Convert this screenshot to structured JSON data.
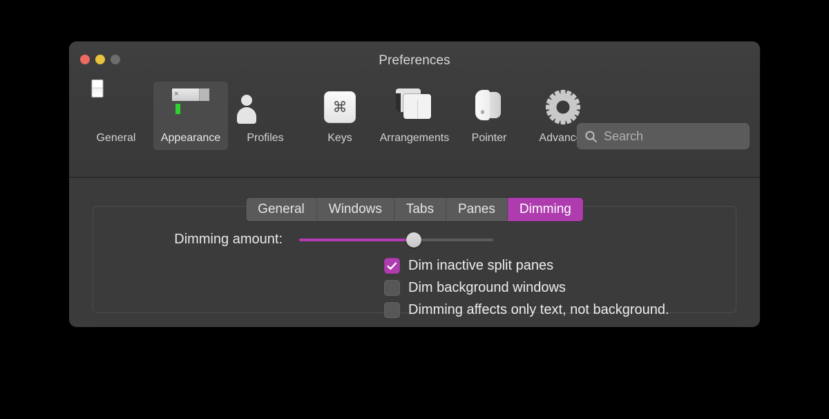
{
  "window": {
    "title": "Preferences",
    "traffic_lights": [
      {
        "name": "close",
        "color": "#ec6a5f"
      },
      {
        "name": "minimize",
        "color": "#e8c33c"
      },
      {
        "name": "zoom",
        "color": "#6d6d6d"
      }
    ]
  },
  "toolbar": {
    "items": [
      {
        "label": "General",
        "icon": "toggle-switch-icon",
        "selected": false
      },
      {
        "label": "Appearance",
        "icon": "terminal-window-icon",
        "selected": true
      },
      {
        "label": "Profiles",
        "icon": "person-circle-icon",
        "selected": false
      },
      {
        "label": "Keys",
        "icon": "command-key-icon",
        "selected": false
      },
      {
        "label": "Arrangements",
        "icon": "stacked-windows-icon",
        "selected": false
      },
      {
        "label": "Pointer",
        "icon": "mouse-icon",
        "selected": false
      },
      {
        "label": "Advanced",
        "icon": "gear-icon",
        "selected": false
      }
    ],
    "search": {
      "icon": "search-icon",
      "placeholder": "Search",
      "value": ""
    }
  },
  "content": {
    "tabs": [
      {
        "label": "General",
        "active": false
      },
      {
        "label": "Windows",
        "active": false
      },
      {
        "label": "Tabs",
        "active": false
      },
      {
        "label": "Panes",
        "active": false
      },
      {
        "label": "Dimming",
        "active": true
      }
    ],
    "slider": {
      "label": "Dimming amount:",
      "value_percent": 59
    },
    "checkboxes": [
      {
        "label": "Dim inactive split panes",
        "checked": true
      },
      {
        "label": "Dim background windows",
        "checked": false
      },
      {
        "label": "Dimming affects only text, not background.",
        "checked": false
      }
    ]
  },
  "colors": {
    "accent": "#ae3cae",
    "window_bg": "#3b3b3b",
    "toolbar_bg": "#3c3c3c",
    "text": "#ededed",
    "desktop_bg": "#000000"
  }
}
